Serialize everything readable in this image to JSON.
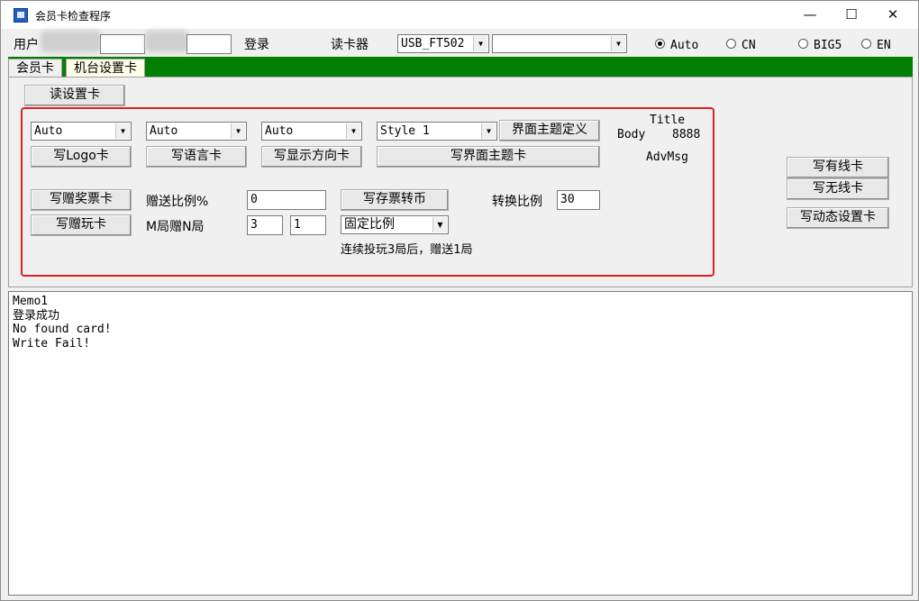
{
  "window": {
    "title": "会员卡检查程序",
    "minimize": "—",
    "maximize": "☐",
    "close": "✕"
  },
  "toolbar": {
    "user_label": "用户",
    "login_label": "登录",
    "reader_label": "读卡器",
    "reader_value": "USB_FT502",
    "reader_option_value": "",
    "radios": [
      {
        "label": "Auto",
        "checked": true
      },
      {
        "label": "CN",
        "checked": false
      },
      {
        "label": "BIG5",
        "checked": false
      },
      {
        "label": "EN",
        "checked": false
      }
    ]
  },
  "tabs": [
    {
      "label": "会员卡"
    },
    {
      "label": "机台设置卡"
    }
  ],
  "panel": {
    "read_settings_button": "读设置卡",
    "combos": {
      "logo": "Auto",
      "language": "Auto",
      "display": "Auto",
      "theme": "Style 1"
    },
    "define_theme_button": "界面主题定义",
    "preview": {
      "title": "Title",
      "body_label": "Body",
      "body_value": "8888",
      "adv": "AdvMsg"
    },
    "write_logo_button": "写Logo卡",
    "write_language_button": "写语言卡",
    "write_direction_button": "写显示方向卡",
    "write_theme_button": "写界面主题卡",
    "write_ticket_bonus_button": "写赠奖票卡",
    "bonus_ratio_label": "赠送比例%",
    "bonus_ratio_value": "0",
    "write_ticket_coin_button": "写存票转币",
    "convert_ratio_label": "转换比例",
    "convert_ratio_value": "30",
    "write_play_bonus_button": "写赠玩卡",
    "mn_label": "M局赠N局",
    "m_value": "3",
    "n_value": "1",
    "mode_value": "固定比例",
    "hint": "连续投玩3局后，赠送1局",
    "write_wired_button": "写有线卡",
    "write_wireless_button": "写无线卡",
    "write_dynamic_button": "写动态设置卡"
  },
  "memo": {
    "lines": [
      "Memo1",
      "登录成功",
      "No found card!",
      "Write Fail!"
    ]
  },
  "colors": {
    "tab_bar": "#038003",
    "highlight_box": "#e02020"
  }
}
